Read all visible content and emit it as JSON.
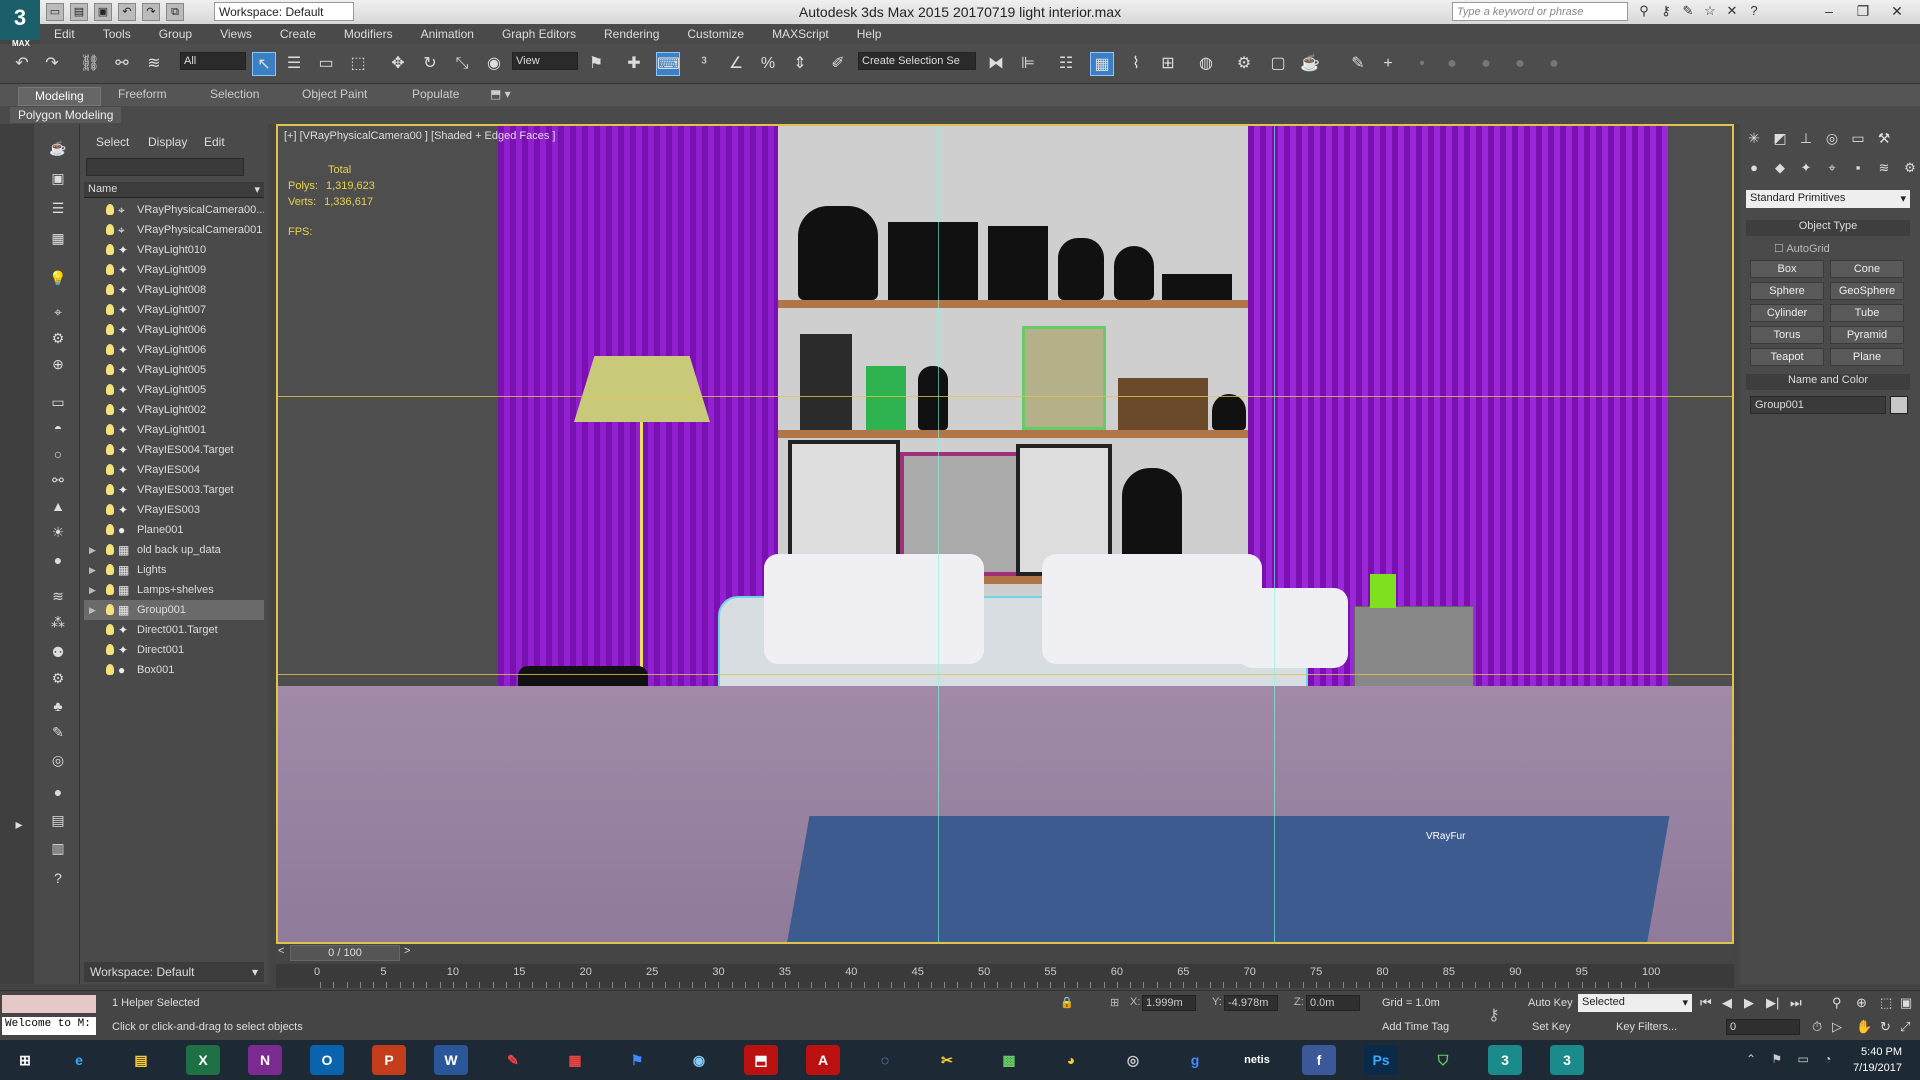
{
  "titlebar": {
    "title": "Autodesk 3ds Max  2015     20170719 light interior.max",
    "workspace": "Workspace: Default",
    "search_placeholder": "Type a keyword or phrase"
  },
  "logo": {
    "text": "3",
    "caption": "MAX"
  },
  "menubar": [
    "Edit",
    "Tools",
    "Group",
    "Views",
    "Create",
    "Modifiers",
    "Animation",
    "Graph Editors",
    "Rendering",
    "Customize",
    "MAXScript",
    "Help"
  ],
  "toolbar": {
    "selection_filter": "All",
    "ref_coord": "View",
    "named_selection": "Create Selection Se"
  },
  "ribbon": {
    "tabs": [
      "Modeling",
      "Freeform",
      "Selection",
      "Object Paint",
      "Populate"
    ],
    "active_panel": "Polygon Modeling"
  },
  "scene_explorer": {
    "tabs": [
      "Select",
      "Display",
      "Edit"
    ],
    "column_header": "Name",
    "items": [
      {
        "name": "VRayPhysicalCamera00...",
        "type": "camera",
        "expand": ""
      },
      {
        "name": "VRayPhysicalCamera001",
        "type": "camera",
        "expand": ""
      },
      {
        "name": "VRayLight010",
        "type": "light",
        "expand": ""
      },
      {
        "name": "VRayLight009",
        "type": "light",
        "expand": ""
      },
      {
        "name": "VRayLight008",
        "type": "light",
        "expand": ""
      },
      {
        "name": "VRayLight007",
        "type": "light",
        "expand": ""
      },
      {
        "name": "VRayLight006",
        "type": "light",
        "expand": ""
      },
      {
        "name": "VRayLight006",
        "type": "light",
        "expand": ""
      },
      {
        "name": "VRayLight005",
        "type": "light",
        "expand": ""
      },
      {
        "name": "VRayLight005",
        "type": "light",
        "expand": ""
      },
      {
        "name": "VRayLight002",
        "type": "light",
        "expand": ""
      },
      {
        "name": "VRayLight001",
        "type": "light",
        "expand": ""
      },
      {
        "name": "VRayIES004.Target",
        "type": "light",
        "expand": ""
      },
      {
        "name": "VRayIES004",
        "type": "light",
        "expand": ""
      },
      {
        "name": "VRayIES003.Target",
        "type": "light",
        "expand": ""
      },
      {
        "name": "VRayIES003",
        "type": "light",
        "expand": ""
      },
      {
        "name": "Plane001",
        "type": "geometry",
        "expand": ""
      },
      {
        "name": "old back up_data",
        "type": "group",
        "expand": "▶"
      },
      {
        "name": "Lights",
        "type": "group",
        "expand": "▶"
      },
      {
        "name": "Lamps+shelves",
        "type": "group",
        "expand": "▶"
      },
      {
        "name": "Group001",
        "type": "group",
        "expand": "▶",
        "selected": true
      },
      {
        "name": "Direct001.Target",
        "type": "light",
        "expand": ""
      },
      {
        "name": "Direct001",
        "type": "light",
        "expand": ""
      },
      {
        "name": "Box001",
        "type": "geometry",
        "expand": ""
      }
    ],
    "workspace_label": "Workspace: Default"
  },
  "viewport": {
    "label": "[+] [VRayPhysicalCamera00 ] [Shaded + Edged Faces ]",
    "stats_total": "Total",
    "polys_label": "Polys:",
    "polys_value": "1,319,623",
    "verts_label": "Verts:",
    "verts_value": "1,336,617",
    "fps_label": "FPS:",
    "vrayfur_label": "VRayFur"
  },
  "command_panel": {
    "primitive_type": "Standard Primitives",
    "object_type_title": "Object Type",
    "autogrid_label": "AutoGrid",
    "buttons": [
      "Box",
      "Cone",
      "Sphere",
      "GeoSphere",
      "Cylinder",
      "Tube",
      "Torus",
      "Pyramid",
      "Teapot",
      "Plane"
    ],
    "name_color_title": "Name and Color",
    "object_name": "Group001"
  },
  "timeline": {
    "frame_display": "0 / 100",
    "ticks": [
      "0",
      "5",
      "10",
      "15",
      "20",
      "25",
      "30",
      "35",
      "40",
      "45",
      "50",
      "55",
      "60",
      "65",
      "70",
      "75",
      "80",
      "85",
      "90",
      "95",
      "100"
    ]
  },
  "status": {
    "maxscript": "Welcome to M:",
    "selection": "1 Helper Selected",
    "hint": "Click or click-and-drag to select objects",
    "x_label": "X:",
    "x_value": "1.999m",
    "y_label": "Y:",
    "y_value": "-4.978m",
    "z_label": "Z:",
    "z_value": "0.0m",
    "grid": "Grid = 1.0m",
    "add_time_tag": "Add Time Tag",
    "auto_key": "Auto Key",
    "set_key": "Set Key",
    "key_mode": "Selected",
    "key_filters": "Key Filters...",
    "current_frame": "0"
  },
  "taskbar": {
    "time": "5:40 PM",
    "date": "7/19/2017"
  }
}
